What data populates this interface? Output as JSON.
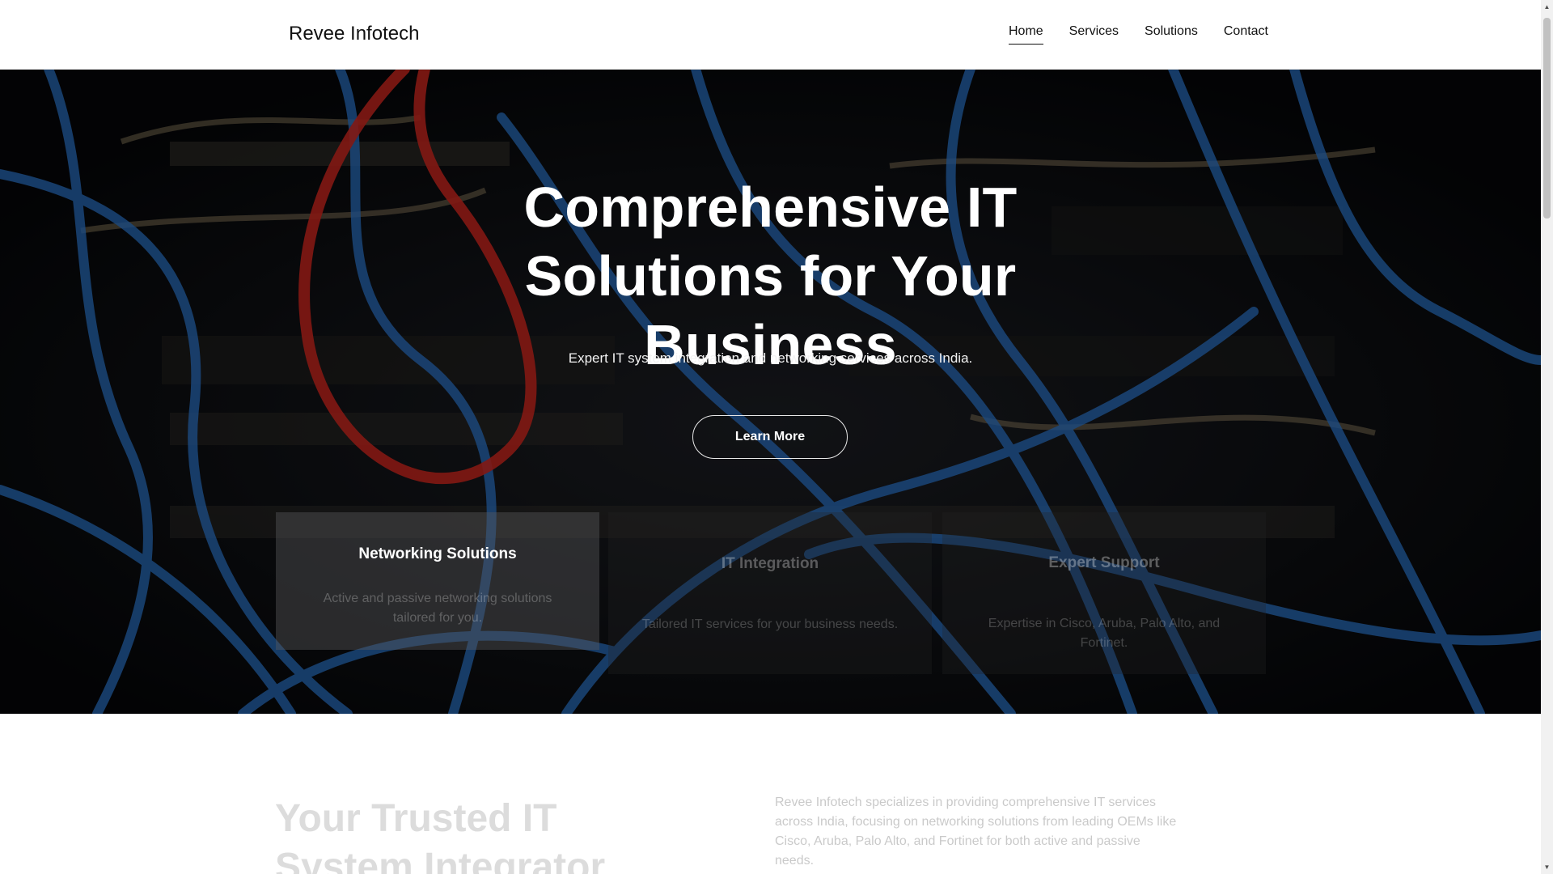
{
  "header": {
    "brand": "Revee Infotech",
    "nav": [
      "Home",
      "Services",
      "Solutions",
      "Contact"
    ],
    "active": "Home"
  },
  "hero": {
    "title": "Comprehensive IT Solutions for Your Business",
    "subtitle": "Expert IT system integration and networking services across India.",
    "button": "Learn More"
  },
  "cards": [
    {
      "title": "Networking Solutions",
      "text": "Active and passive networking solutions tailored for you."
    },
    {
      "title": "IT Integration",
      "text": "Tailored IT services for your business needs."
    },
    {
      "title": "Expert Support",
      "text": "Expertise in Cisco, Aruba, Palo Alto, and Fortinet."
    }
  ],
  "about": {
    "title": "Your Trusted IT System Integrator",
    "text": "Revee Infotech specializes in providing comprehensive IT services across India, focusing on networking solutions from leading OEMs like Cisco, Aruba, Palo Alto, and Fortinet for both active and passive needs."
  },
  "colors": {
    "cable_blue": "#2b73c8",
    "cable_red": "#c8261e",
    "hero_bg": "#08090c"
  }
}
